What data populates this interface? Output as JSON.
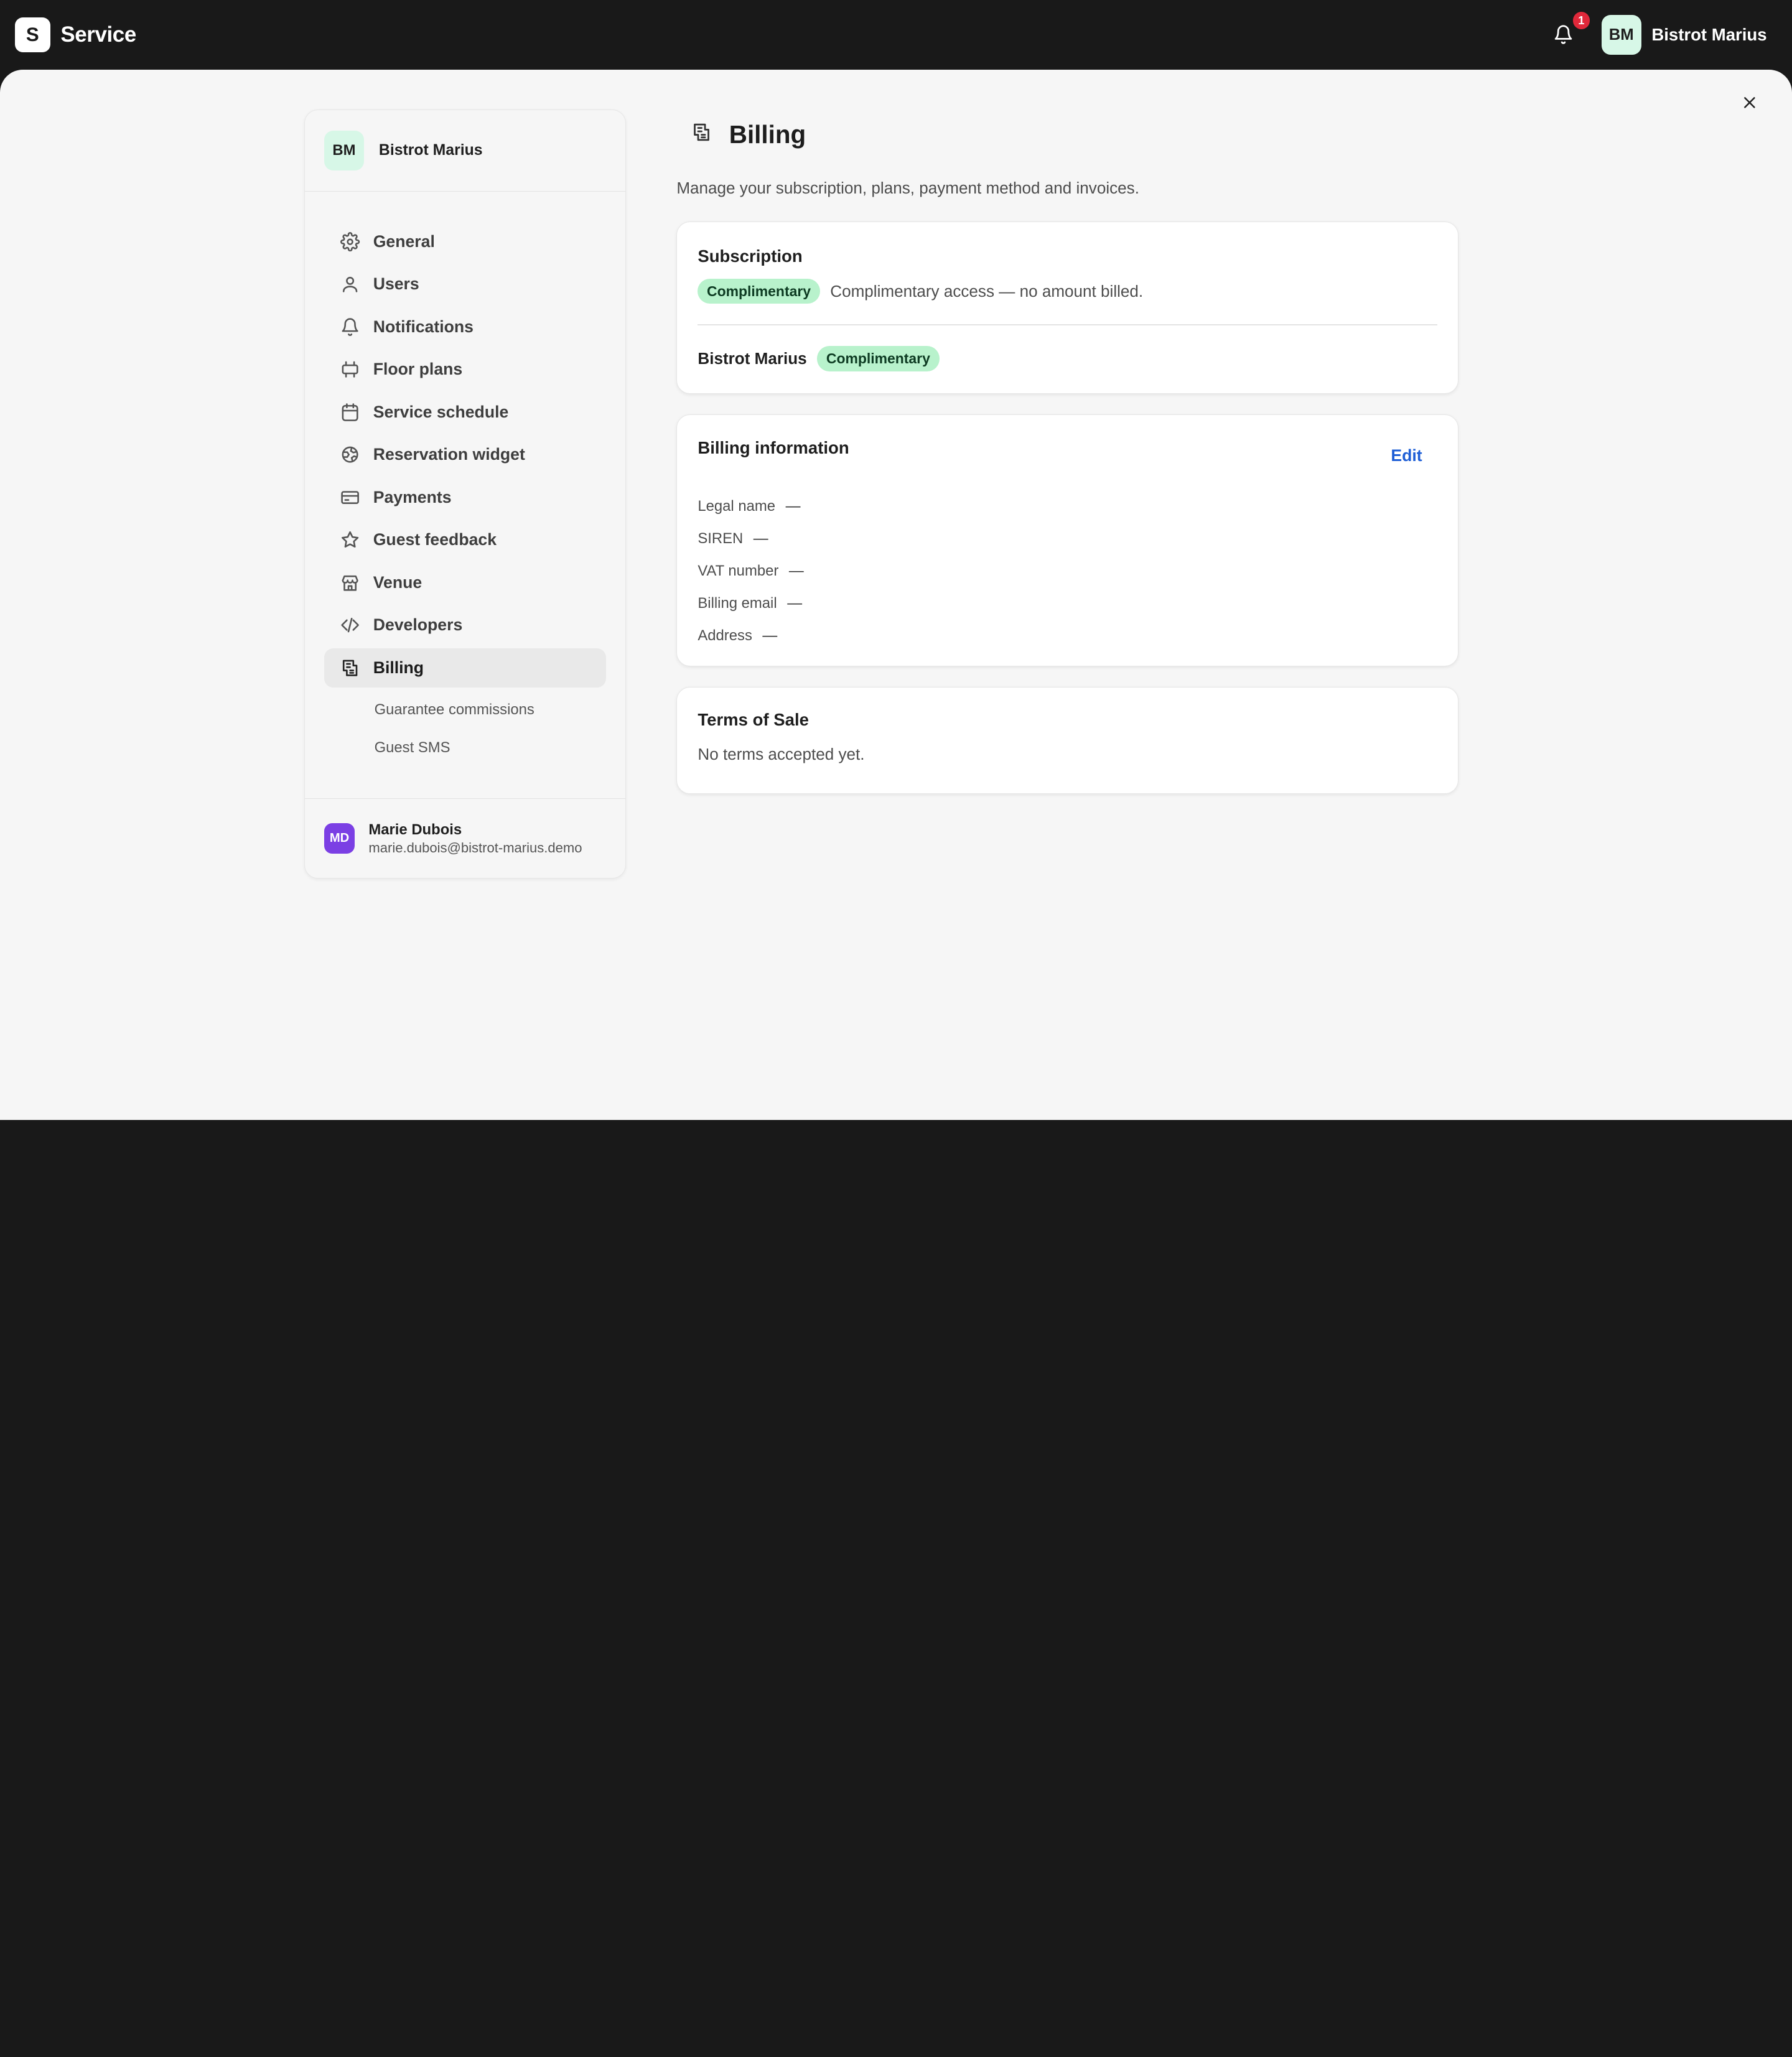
{
  "app": {
    "logo_letter": "S",
    "name": "Service"
  },
  "topbar": {
    "notification_count": "1",
    "avatar_initials": "BM",
    "venue_name": "Bistrot Marius"
  },
  "sidebar": {
    "venue_initials": "BM",
    "venue_name": "Bistrot Marius",
    "items": [
      {
        "label": "General",
        "icon": "gear-icon"
      },
      {
        "label": "Users",
        "icon": "user-icon"
      },
      {
        "label": "Notifications",
        "icon": "bell-icon"
      },
      {
        "label": "Floor plans",
        "icon": "table-icon"
      },
      {
        "label": "Service schedule",
        "icon": "calendar-icon"
      },
      {
        "label": "Reservation widget",
        "icon": "globe-icon"
      },
      {
        "label": "Payments",
        "icon": "credit-card-icon"
      },
      {
        "label": "Guest feedback",
        "icon": "star-icon"
      },
      {
        "label": "Venue",
        "icon": "store-icon"
      },
      {
        "label": "Developers",
        "icon": "code-icon"
      },
      {
        "label": "Billing",
        "icon": "receipt-icon",
        "active": true
      }
    ],
    "sub_items": [
      {
        "label": "Guarantee commissions"
      },
      {
        "label": "Guest SMS"
      }
    ],
    "user": {
      "initials": "MD",
      "name": "Marie Dubois",
      "email": "marie.dubois@bistrot-marius.demo"
    }
  },
  "page": {
    "title": "Billing",
    "description": "Manage your subscription, plans, payment method and invoices."
  },
  "subscription": {
    "title": "Subscription",
    "badge": "Complimentary",
    "note": "Complimentary access — no amount billed.",
    "venue_name": "Bistrot Marius",
    "venue_badge": "Complimentary"
  },
  "billing_info": {
    "title": "Billing information",
    "edit_label": "Edit",
    "fields": [
      {
        "label": "Legal name",
        "value": "—"
      },
      {
        "label": "SIREN",
        "value": "—"
      },
      {
        "label": "VAT number",
        "value": "—"
      },
      {
        "label": "Billing email",
        "value": "—"
      },
      {
        "label": "Address",
        "value": "—"
      }
    ]
  },
  "terms": {
    "title": "Terms of Sale",
    "text": "No terms accepted yet."
  },
  "colors": {
    "accent_link": "#1f5fd6",
    "badge_bg": "#b8f2cc",
    "badge_notif": "#e0283a",
    "user_avatar": "#7b3fe4"
  }
}
